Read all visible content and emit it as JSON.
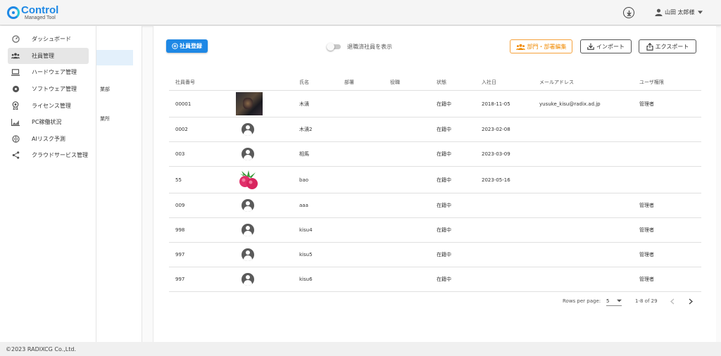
{
  "app": {
    "title": "Control",
    "subtitle": "Managed Tool"
  },
  "header": {
    "user_name": "山田 太郎様"
  },
  "sidebar": {
    "items": [
      {
        "label": "ダッシュボード",
        "icon": "speedometer-icon",
        "active": false
      },
      {
        "label": "社員管理",
        "icon": "people-icon",
        "active": true
      },
      {
        "label": "ハードウェア管理",
        "icon": "laptop-icon",
        "active": false
      },
      {
        "label": "ソフトウェア管理",
        "icon": "disc-icon",
        "active": false
      },
      {
        "label": "ライセンス管理",
        "icon": "award-icon",
        "active": false
      },
      {
        "label": "PC稼働状況",
        "icon": "chart-area-icon",
        "active": false
      },
      {
        "label": "AIリスク予測",
        "icon": "brain-icon",
        "active": false
      },
      {
        "label": "クラウドサービス管理",
        "icon": "share-icon",
        "active": false
      }
    ]
  },
  "subpanel": {
    "items": [
      "業部",
      "業所"
    ]
  },
  "toolbar": {
    "register_label": "社員登録",
    "toggle_label": "退職済社員を表示",
    "dept_edit_label": "部門・部署編集",
    "import_label": "インポート",
    "export_label": "エクスポート"
  },
  "table": {
    "headers": [
      "社員番号",
      "",
      "氏名",
      "部署",
      "役職",
      "状態",
      "入社日",
      "メールアドレス",
      "ユーザ権限"
    ],
    "rows": [
      {
        "id": "00001",
        "avatar": "photo-dark",
        "name": "木漬",
        "dept": "",
        "position": "",
        "status": "在籍中",
        "joined": "2018-11-05",
        "email": "yusuke_kisu@radix.ad.jp",
        "role": "管理者"
      },
      {
        "id": "0002",
        "avatar": "default",
        "name": "木漬2",
        "dept": "",
        "position": "",
        "status": "在籍中",
        "joined": "2023-02-08",
        "email": "",
        "role": ""
      },
      {
        "id": "003",
        "avatar": "default",
        "name": "相馬",
        "dept": "",
        "position": "",
        "status": "在籍中",
        "joined": "2023-03-09",
        "email": "",
        "role": ""
      },
      {
        "id": "55",
        "avatar": "photo-fruit",
        "name": "bao",
        "dept": "",
        "position": "",
        "status": "在籍中",
        "joined": "2023-05-16",
        "email": "",
        "role": ""
      },
      {
        "id": "009",
        "avatar": "default",
        "name": "aaa",
        "dept": "",
        "position": "",
        "status": "在籍中",
        "joined": "",
        "email": "",
        "role": "管理者"
      },
      {
        "id": "998",
        "avatar": "default",
        "name": "kisu4",
        "dept": "",
        "position": "",
        "status": "在籍中",
        "joined": "",
        "email": "",
        "role": "管理者"
      },
      {
        "id": "997",
        "avatar": "default",
        "name": "kisu5",
        "dept": "",
        "position": "",
        "status": "在籍中",
        "joined": "",
        "email": "",
        "role": "管理者"
      },
      {
        "id": "997",
        "avatar": "default",
        "name": "kisu6",
        "dept": "",
        "position": "",
        "status": "在籍中",
        "joined": "",
        "email": "",
        "role": "管理者"
      }
    ]
  },
  "pagination": {
    "rows_per_page_label": "Rows per page:",
    "rows_per_page": "5",
    "range": "1-8 of 29"
  },
  "footer": {
    "copyright": "©2023 RADIXCG Co.,Ltd."
  },
  "colors": {
    "primary": "#1e88e5",
    "accent_orange": "#f08a00"
  }
}
